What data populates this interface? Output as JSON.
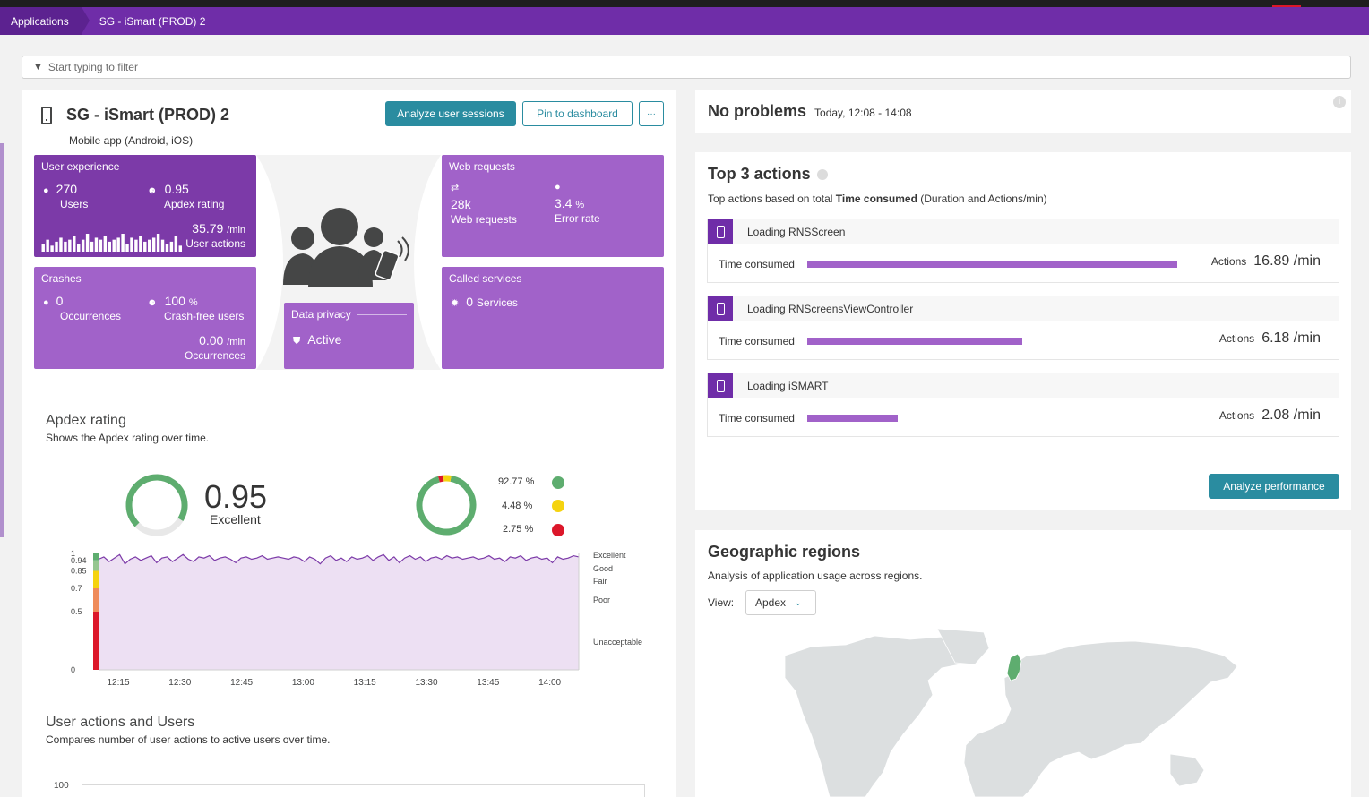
{
  "nav": {
    "breadcrumb_root": "Applications",
    "breadcrumb_current": "SG - iSmart (PROD) 2"
  },
  "filter": {
    "placeholder": "Start typing to filter"
  },
  "app": {
    "title": "SG - iSmart (PROD) 2",
    "subtitle": "Mobile app (Android, iOS)",
    "analyze_sessions_label": "Analyze user sessions",
    "pin_label": "Pin to dashboard",
    "more_label": "···"
  },
  "tiles": {
    "user_experience": {
      "title": "User experience",
      "users_value": "270",
      "users_label": "Users",
      "apdex_value": "0.95",
      "apdex_label": "Apdex rating",
      "actions_value": "35.79",
      "actions_unit": "/min",
      "actions_label": "User actions",
      "sparkline": [
        4,
        6,
        3,
        5,
        7,
        5,
        6,
        8,
        4,
        6,
        9,
        5,
        7,
        6,
        8,
        5,
        6,
        7,
        9,
        4,
        7,
        6,
        8,
        5,
        6,
        7,
        9,
        6,
        4,
        5,
        8,
        3
      ]
    },
    "crashes": {
      "title": "Crashes",
      "occ_value": "0",
      "occ_label": "Occurrences",
      "cf_value": "100",
      "cf_unit": "%",
      "cf_label": "Crash-free users",
      "rate_value": "0.00",
      "rate_unit": "/min",
      "rate_label": "Occurrences"
    },
    "data_privacy": {
      "title": "Data privacy",
      "status": "Active"
    },
    "web_requests": {
      "title": "Web requests",
      "req_value": "28k",
      "req_label": "Web requests",
      "err_value": "3.4",
      "err_unit": "%",
      "err_label": "Error rate"
    },
    "called_services": {
      "title": "Called services",
      "value": "0",
      "label": "Services"
    }
  },
  "apdex": {
    "title": "Apdex rating",
    "subtitle": "Shows the Apdex rating over time.",
    "score": 0.95,
    "score_text": "0.95",
    "score_label": "Excellent",
    "distribution": [
      {
        "pct": 92.77,
        "label": "92.77 %",
        "color": "#5ead6f"
      },
      {
        "pct": 4.48,
        "label": "4.48 %",
        "color": "#f5d30f"
      },
      {
        "pct": 2.75,
        "label": "2.75 %",
        "color": "#dc172a"
      }
    ],
    "zones": [
      {
        "label": "Excellent",
        "from": 0.94,
        "to": 1.0,
        "color": "#5ead6f"
      },
      {
        "label": "Good",
        "from": 0.85,
        "to": 0.94,
        "color": "#96c690"
      },
      {
        "label": "Fair",
        "from": 0.7,
        "to": 0.85,
        "color": "#f5d30f"
      },
      {
        "label": "Poor",
        "from": 0.5,
        "to": 0.7,
        "color": "#ef8b5a"
      },
      {
        "label": "Unacceptable",
        "from": 0,
        "to": 0.5,
        "color": "#dc172a"
      }
    ],
    "chart": {
      "type": "area",
      "x_ticks": [
        "12:15",
        "12:30",
        "12:45",
        "13:00",
        "13:15",
        "13:30",
        "13:45",
        "14:00"
      ],
      "y_ticks": [
        {
          "value": 1,
          "label": "1"
        },
        {
          "value": 0.94,
          "label": "0.94"
        },
        {
          "value": 0.85,
          "label": "0.85"
        },
        {
          "value": 0.7,
          "label": "0.7"
        },
        {
          "value": 0.5,
          "label": "0.5"
        },
        {
          "value": 0,
          "label": "0"
        }
      ],
      "ylim": [
        0,
        1
      ],
      "values": [
        0.95,
        0.97,
        0.93,
        0.96,
        0.99,
        0.91,
        0.95,
        0.97,
        0.94,
        0.96,
        0.98,
        0.92,
        0.96,
        0.97,
        0.93,
        0.96,
        0.99,
        0.95,
        0.93,
        0.97,
        0.96,
        0.98,
        0.94,
        0.96,
        0.97,
        0.95,
        0.92,
        0.96,
        0.97,
        0.95,
        0.96,
        0.98,
        0.95,
        0.96,
        0.97,
        0.96,
        0.95,
        0.97,
        0.96,
        0.93,
        0.97,
        0.95,
        0.91,
        0.96,
        0.98,
        0.94,
        0.96,
        0.93,
        0.97,
        0.95,
        0.96,
        0.98,
        0.94,
        0.97,
        0.99,
        0.94,
        0.97,
        0.92,
        0.96,
        0.98,
        0.95,
        0.97,
        0.93,
        0.96,
        0.97,
        0.95,
        0.98,
        0.96,
        0.97,
        0.95,
        0.96,
        0.97,
        0.95,
        0.96,
        0.98,
        0.95,
        0.96,
        0.93,
        0.97,
        0.96,
        0.98,
        0.94,
        0.96,
        0.97,
        0.95,
        0.96,
        0.92,
        0.97,
        0.95,
        0.96,
        0.98,
        0.97
      ]
    }
  },
  "user_actions_section": {
    "title": "User actions and Users",
    "subtitle": "Compares number of user actions to active users over time.",
    "y_top": "100"
  },
  "problems": {
    "title": "No problems",
    "time": "Today, 12:08 - 14:08"
  },
  "top_actions": {
    "title": "Top 3 actions",
    "desc_prefix": "Top actions based on total ",
    "desc_bold": "Time consumed",
    "desc_suffix": " (Duration and Actions/min)",
    "time_consumed_label": "Time consumed",
    "actions_label": "Actions",
    "items": [
      {
        "name": "Loading RNSScreen",
        "share": 1.0,
        "rate": "16.89 /min"
      },
      {
        "name": "Loading RNScreensViewController",
        "share": 0.58,
        "rate": "6.18 /min"
      },
      {
        "name": "Loading iSMART",
        "share": 0.245,
        "rate": "2.08 /min"
      }
    ],
    "analyze_performance_label": "Analyze performance"
  },
  "geo": {
    "title": "Geographic regions",
    "subtitle": "Analysis of application usage across regions.",
    "view_label": "View:",
    "view_value": "Apdex"
  },
  "colors": {
    "nav": "#6f2da8",
    "tile": "#a162c9",
    "primary": "#2a8ca0",
    "excellent": "#5ead6f"
  }
}
